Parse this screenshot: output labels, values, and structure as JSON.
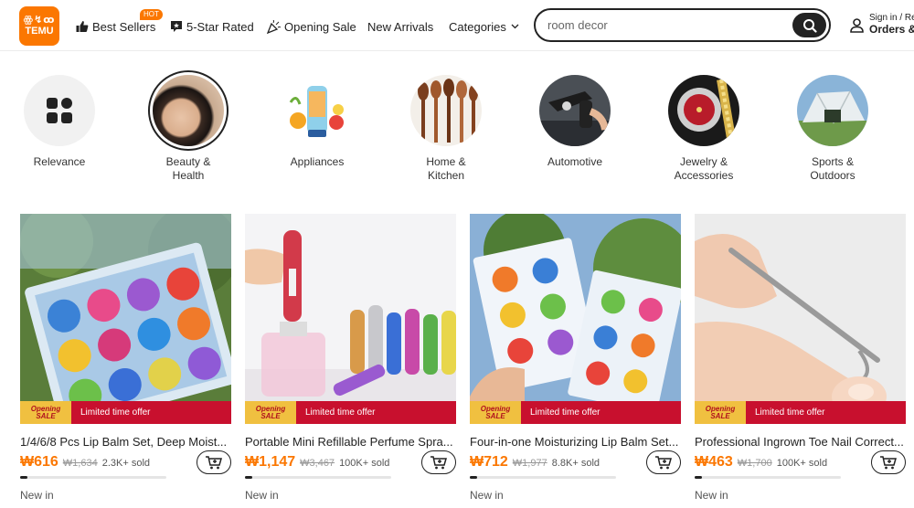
{
  "header": {
    "logo_line1": "ꙮ↯ꝏ",
    "logo_line2": "TEMU",
    "nav": [
      {
        "label": "Best Sellers",
        "icon": "thumbs-up-icon"
      },
      {
        "label": "5-Star Rated",
        "icon": "star-review-icon"
      },
      {
        "label": "Opening Sale",
        "icon": "party-popper-icon"
      },
      {
        "label": "New Arrivals",
        "icon": ""
      },
      {
        "label": "Categories",
        "icon": "chevron-down-icon"
      }
    ],
    "hot_badge": "HOT",
    "search": {
      "value": "room decor",
      "icon": "search-icon"
    },
    "account": {
      "line1": "Sign in / Re",
      "line2": "Orders &",
      "icon": "user-icon"
    }
  },
  "categories": [
    {
      "label_line1": "Relevance",
      "label_line2": "",
      "selected": false,
      "icon": "grid-icon"
    },
    {
      "label_line1": "Beauty &",
      "label_line2": "Health",
      "selected": true
    },
    {
      "label_line1": "Appliances",
      "label_line2": "",
      "selected": false
    },
    {
      "label_line1": "Home &",
      "label_line2": "Kitchen",
      "selected": false
    },
    {
      "label_line1": "Automotive",
      "label_line2": "",
      "selected": false
    },
    {
      "label_line1": "Jewelry &",
      "label_line2": "Accessories",
      "selected": false
    },
    {
      "label_line1": "Sports &",
      "label_line2": "Outdoors",
      "selected": false
    }
  ],
  "products": [
    {
      "title": "1/4/6/8 Pcs Lip Balm Set, Deep Moist...",
      "price": "₩616",
      "old_price": "₩1,634",
      "sold": "2.3K+ sold",
      "sale_text": "Limited time offer",
      "badge_line1": "Opening",
      "badge_line2": "SALE",
      "status": "New in",
      "progress": 0.05
    },
    {
      "title": "Portable Mini Refillable Perfume Spra...",
      "price": "₩1,147",
      "old_price": "₩3,467",
      "sold": "100K+ sold",
      "sale_text": "Limited time offer",
      "badge_line1": "Opening",
      "badge_line2": "SALE",
      "status": "New in",
      "progress": 0.05
    },
    {
      "title": "Four-in-one Moisturizing Lip Balm Set...",
      "price": "₩712",
      "old_price": "₩1,977",
      "sold": "8.8K+ sold",
      "sale_text": "Limited time offer",
      "badge_line1": "Opening",
      "badge_line2": "SALE",
      "status": "New in",
      "progress": 0.05
    },
    {
      "title": "Professional Ingrown Toe Nail Correct...",
      "price": "₩463",
      "old_price": "₩1,700",
      "sold": "100K+ sold",
      "sale_text": "Limited time offer",
      "badge_line1": "Opening",
      "badge_line2": "SALE",
      "status": "New in",
      "progress": 0.05
    }
  ],
  "colors": {
    "brand": "#fb7701",
    "sale_red": "#c8102e",
    "sale_gold": "#f0c040"
  }
}
